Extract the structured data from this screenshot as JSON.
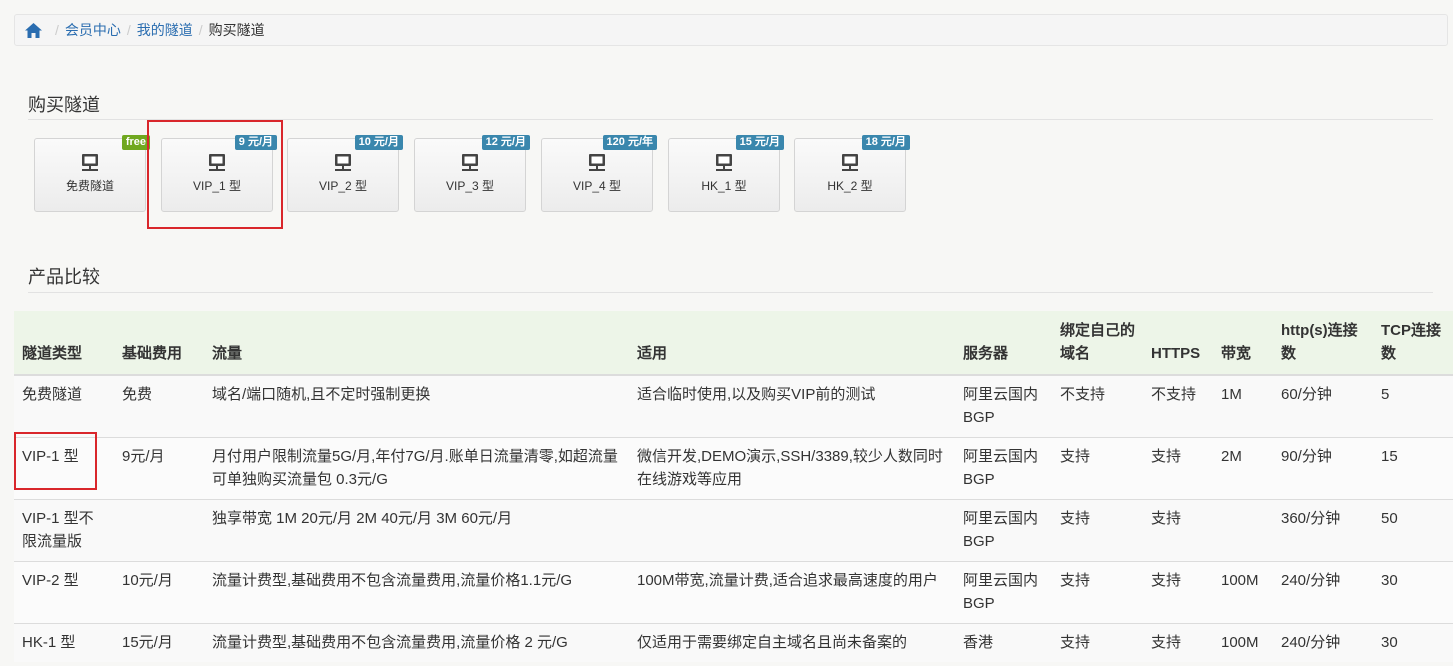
{
  "breadcrumb": {
    "items": [
      "会员中心",
      "我的隧道"
    ],
    "current": "购买隧道"
  },
  "purchase_title": "购买隧道",
  "tunnels": [
    {
      "label": "免费隧道",
      "badge": "free"
    },
    {
      "label": "VIP_1 型",
      "badge": "9 元/月"
    },
    {
      "label": "VIP_2 型",
      "badge": "10 元/月"
    },
    {
      "label": "VIP_3 型",
      "badge": "12 元/月"
    },
    {
      "label": "VIP_4 型",
      "badge": "120 元/年"
    },
    {
      "label": "HK_1 型",
      "badge": "15 元/月"
    },
    {
      "label": "HK_2 型",
      "badge": "18 元/月"
    }
  ],
  "compare_title": "产品比较",
  "table": {
    "headers": [
      "隧道类型",
      "基础费用",
      "流量",
      "适用",
      "服务器",
      "绑定自己的域名",
      "HTTPS",
      "带宽",
      "http(s)连接数",
      "TCP连接数"
    ],
    "rows": [
      [
        "免费隧道",
        "免费",
        "域名/端口随机,且不定时强制更换",
        "适合临时使用,以及购买VIP前的测试",
        "阿里云国内BGP",
        "不支持",
        "不支持",
        "1M",
        "60/分钟",
        "5"
      ],
      [
        "VIP-1 型",
        "9元/月",
        "月付用户限制流量5G/月,年付7G/月.账单日流量清零,如超流量可单独购买流量包 0.3元/G",
        "微信开发,DEMO演示,SSH/3389,较少人数同时在线游戏等应用",
        "阿里云国内BGP",
        "支持",
        "支持",
        "2M",
        "90/分钟",
        "15"
      ],
      [
        "VIP-1 型不限流量版",
        "",
        "独享带宽 1M 20元/月 2M 40元/月 3M 60元/月",
        "",
        "阿里云国内BGP",
        "支持",
        "支持",
        "",
        "360/分钟",
        "50"
      ],
      [
        "VIP-2 型",
        "10元/月",
        "流量计费型,基础费用不包含流量费用,流量价格1.1元/G",
        "100M带宽,流量计费,适合追求最高速度的用户",
        "阿里云国内BGP",
        "支持",
        "支持",
        "100M",
        "240/分钟",
        "30"
      ],
      [
        "HK-1 型",
        "15元/月",
        "流量计费型,基础费用不包含流量费用,流量价格 2 元/G",
        "仅适用于需要绑定自主域名且尚未备案的",
        "香港",
        "支持",
        "支持",
        "100M",
        "240/分钟",
        "30"
      ]
    ]
  },
  "colors": {
    "link": "#2a6db0",
    "badge_price": "#3a87ad",
    "badge_free": "#70a81f",
    "highlight": "#d9262b",
    "table_header_bg": "#edf5e8"
  }
}
